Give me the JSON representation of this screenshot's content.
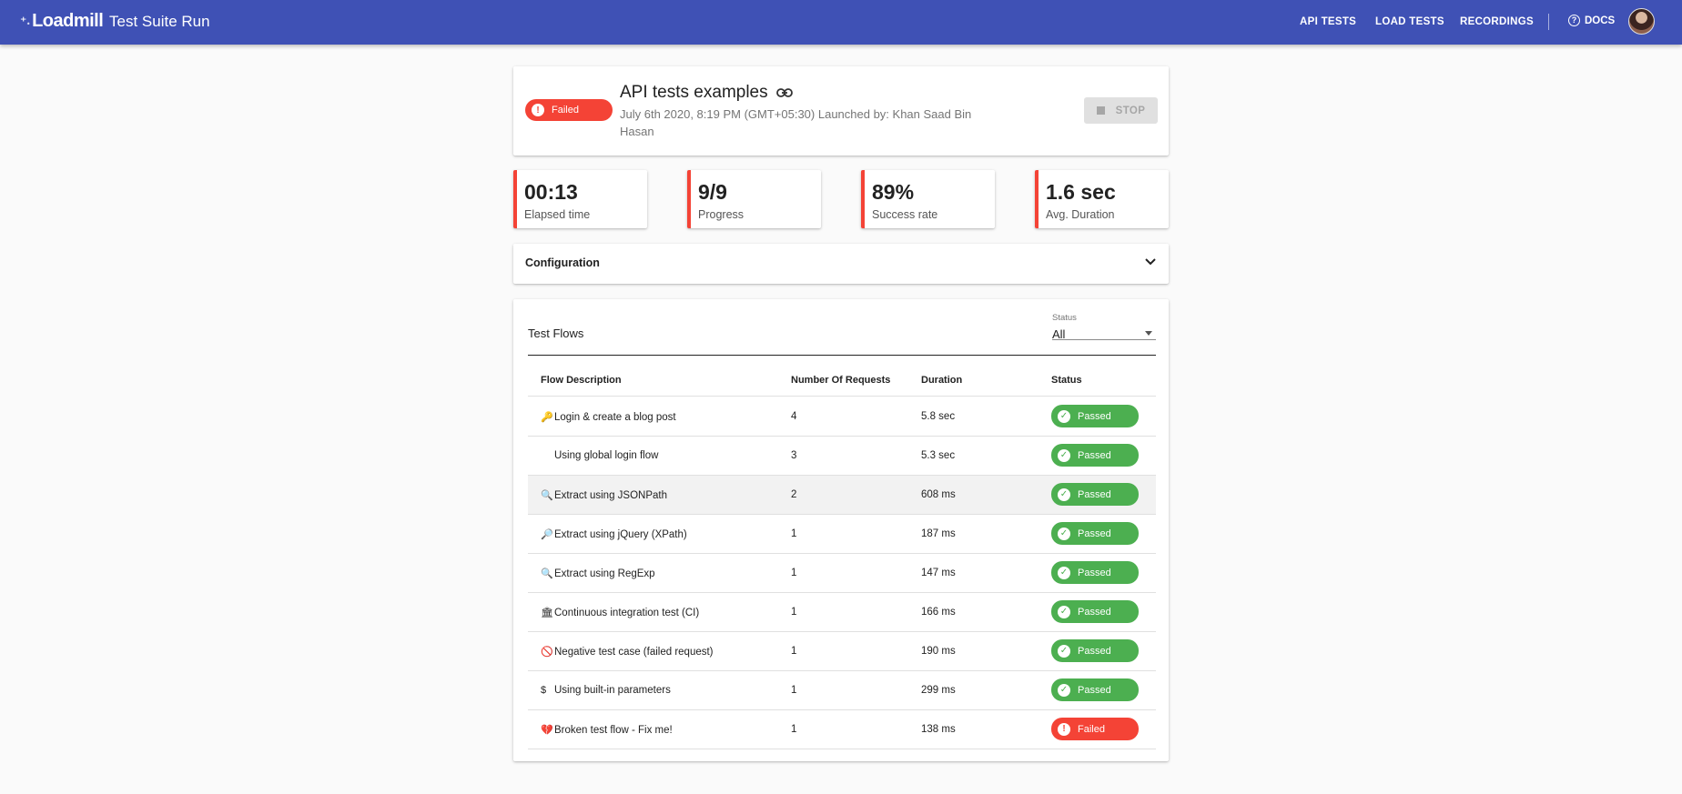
{
  "topbar": {
    "logo": "Loadmill",
    "logo_mark": "⁺˖",
    "page_title": "Test Suite Run",
    "nav": {
      "api_tests": "API TESTS",
      "load_tests": "LOAD TESTS",
      "recordings": "RECORDINGS",
      "docs": "DOCS"
    },
    "color": "#3f51b5"
  },
  "run": {
    "status": "Failed",
    "title": "API tests examples",
    "meta": "July 6th 2020, 8:19 PM (GMT+05:30) Launched by: Khan Saad Bin Hasan",
    "stop_label": "STOP"
  },
  "metrics": [
    {
      "value": "00:13",
      "label": "Elapsed time"
    },
    {
      "value": "9/9",
      "label": "Progress"
    },
    {
      "value": "89%",
      "label": "Success rate"
    },
    {
      "value": "1.6 sec",
      "label": "Avg. Duration"
    }
  ],
  "configuration": {
    "label": "Configuration"
  },
  "flows": {
    "title": "Test Flows",
    "filter": {
      "label": "Status",
      "value": "All"
    },
    "columns": [
      "Flow Description",
      "Number Of Requests",
      "Duration",
      "Status"
    ],
    "rows": [
      {
        "icon": "🔑",
        "description": "Login & create a blog post",
        "requests": "4",
        "duration": "5.8 sec",
        "status": "Passed"
      },
      {
        "icon": "",
        "description": "Using global login flow",
        "requests": "3",
        "duration": "5.3 sec",
        "status": "Passed"
      },
      {
        "icon": "🔍",
        "description": "Extract using JSONPath",
        "requests": "2",
        "duration": "608 ms",
        "status": "Passed"
      },
      {
        "icon": "🔎",
        "description": "Extract using jQuery (XPath)",
        "requests": "1",
        "duration": "187 ms",
        "status": "Passed"
      },
      {
        "icon": "🔍",
        "description": "Extract using RegExp",
        "requests": "1",
        "duration": "147 ms",
        "status": "Passed"
      },
      {
        "icon": "🏛",
        "description": "Continuous integration test (CI)",
        "requests": "1",
        "duration": "166 ms",
        "status": "Passed"
      },
      {
        "icon": "🚫",
        "description": "Negative test case (failed request)",
        "requests": "1",
        "duration": "190 ms",
        "status": "Passed"
      },
      {
        "icon": "$",
        "description": "Using built-in parameters",
        "requests": "1",
        "duration": "299 ms",
        "status": "Passed"
      },
      {
        "icon": "💔",
        "description": "Broken test flow - Fix me!",
        "requests": "1",
        "duration": "138 ms",
        "status": "Failed"
      }
    ]
  },
  "colors": {
    "failed": "#f44336",
    "passed": "#4caf50"
  }
}
